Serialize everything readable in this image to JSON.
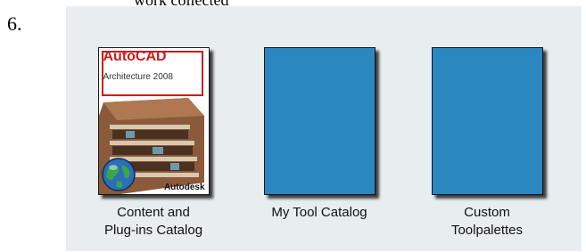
{
  "step": {
    "number": "6.",
    "clipped_heading": "work collected"
  },
  "catalogs": [
    {
      "label": "Content and\nPlug-ins Catalog",
      "cover": {
        "type": "art",
        "brand": "AutoCAD",
        "product": "Architecture 2008",
        "vendor": "Autodesk"
      }
    },
    {
      "label": "My Tool Catalog",
      "cover": {
        "type": "blank",
        "color": "#2a87c0"
      }
    },
    {
      "label": "Custom\nToolpalettes",
      "cover": {
        "type": "blank",
        "color": "#2a87c0"
      }
    }
  ]
}
